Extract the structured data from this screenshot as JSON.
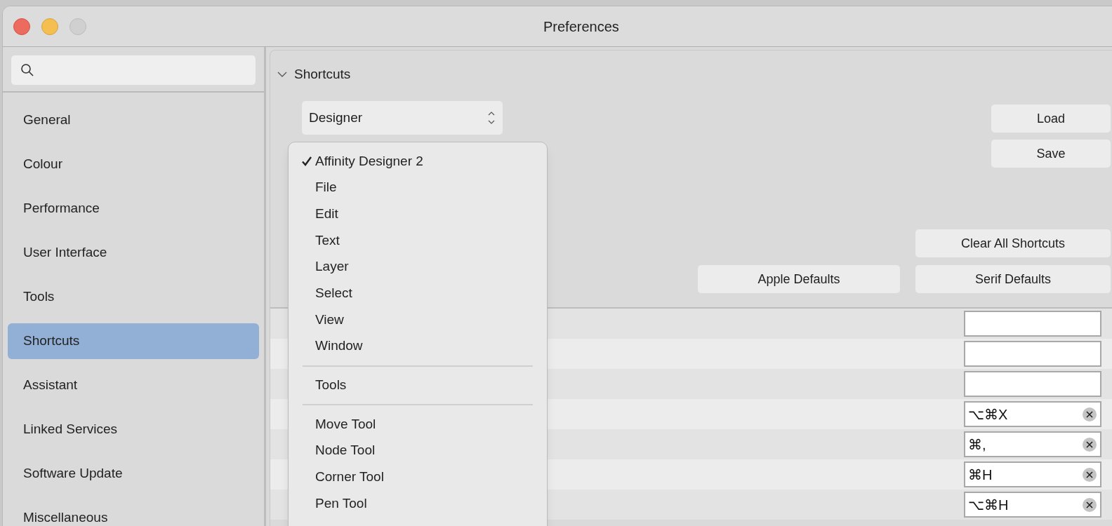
{
  "window": {
    "title": "Preferences"
  },
  "sidebar": {
    "items": [
      {
        "label": "General",
        "selected": false
      },
      {
        "label": "Colour",
        "selected": false
      },
      {
        "label": "Performance",
        "selected": false
      },
      {
        "label": "User Interface",
        "selected": false
      },
      {
        "label": "Tools",
        "selected": false
      },
      {
        "label": "Shortcuts",
        "selected": true
      },
      {
        "label": "Assistant",
        "selected": false
      },
      {
        "label": "Linked Services",
        "selected": false
      },
      {
        "label": "Software Update",
        "selected": false
      },
      {
        "label": "Miscellaneous",
        "selected": false
      }
    ]
  },
  "section": {
    "title": "Shortcuts",
    "expanded": true
  },
  "app_select": {
    "value": "Designer"
  },
  "buttons": {
    "load": "Load",
    "save": "Save",
    "clear_all": "Clear All Shortcuts",
    "apple_defaults": "Apple Defaults",
    "serif_defaults": "Serif Defaults"
  },
  "rows": [
    {
      "shortcut": null
    },
    {
      "shortcut": null
    },
    {
      "shortcut": null
    },
    {
      "shortcut": "⌥⌘X"
    },
    {
      "shortcut": "⌘,"
    },
    {
      "shortcut": "⌘H"
    },
    {
      "shortcut": "⌥⌘H"
    }
  ],
  "menu": {
    "items": [
      {
        "kind": "item",
        "label": "Affinity Designer 2",
        "selected": true
      },
      {
        "kind": "item",
        "label": "File",
        "selected": false
      },
      {
        "kind": "item",
        "label": "Edit",
        "selected": false
      },
      {
        "kind": "item",
        "label": "Text",
        "selected": false
      },
      {
        "kind": "item",
        "label": "Layer",
        "selected": false
      },
      {
        "kind": "item",
        "label": "Select",
        "selected": false
      },
      {
        "kind": "item",
        "label": "View",
        "selected": false
      },
      {
        "kind": "item",
        "label": "Window",
        "selected": false
      },
      {
        "kind": "separator"
      },
      {
        "kind": "item",
        "label": "Tools",
        "selected": false
      },
      {
        "kind": "separator"
      },
      {
        "kind": "item",
        "label": "Move Tool",
        "selected": false
      },
      {
        "kind": "item",
        "label": "Node Tool",
        "selected": false
      },
      {
        "kind": "item",
        "label": "Corner Tool",
        "selected": false
      },
      {
        "kind": "item",
        "label": "Pen Tool",
        "selected": false
      }
    ]
  }
}
